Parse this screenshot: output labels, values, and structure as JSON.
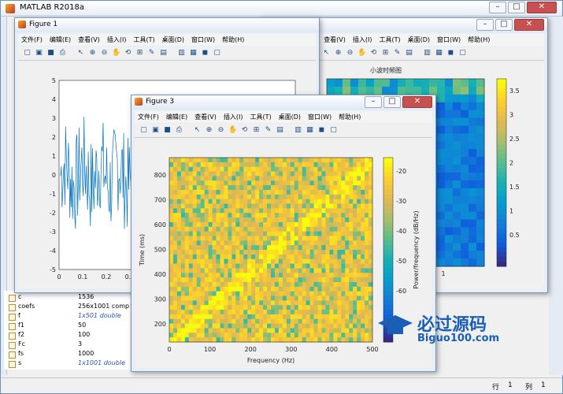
{
  "main": {
    "title": "MATLAB R2018a"
  },
  "menu": [
    "文件(F)",
    "编辑(E)",
    "查看(V)",
    "插入(I)",
    "工具(T)",
    "桌面(D)",
    "窗口(W)",
    "帮助(H)"
  ],
  "fig1": {
    "title": "Figure 1",
    "yticks": [
      "5",
      "4",
      "3",
      "2",
      "1",
      "0",
      "-1",
      "-2",
      "-3",
      "-4",
      "-5"
    ],
    "xticks": [
      "0",
      "0.1",
      "0.2",
      "0.3"
    ]
  },
  "fig2": {
    "title": "小波时频图",
    "colorbar_ticks": [
      "3.5",
      "3",
      "2.5",
      "2",
      "1.5",
      "1",
      "0.5"
    ],
    "xticks": [
      ".8",
      "1"
    ]
  },
  "fig3": {
    "title": "Figure 3",
    "xlabel": "Frequency (Hz)",
    "ylabel": "Time (ms)",
    "cblabel": "Power/frequency (dB/Hz)",
    "xticks": [
      "0",
      "100",
      "200",
      "300",
      "400",
      "500"
    ],
    "yticks": [
      "800",
      "700",
      "600",
      "500",
      "400",
      "300",
      "200"
    ],
    "cbticks": [
      "-20",
      "-30",
      "-40",
      "-50",
      "-60"
    ]
  },
  "workspace": [
    {
      "name": "c",
      "value": "1536",
      "italic": false
    },
    {
      "name": "coefs",
      "value": "256x1001 comp",
      "italic": false
    },
    {
      "name": "f",
      "value": "1x501 double",
      "italic": true
    },
    {
      "name": "f1",
      "value": "50",
      "italic": false
    },
    {
      "name": "f2",
      "value": "100",
      "italic": false
    },
    {
      "name": "Fc",
      "value": "3",
      "italic": false
    },
    {
      "name": "fs",
      "value": "1000",
      "italic": false
    },
    {
      "name": "s",
      "value": "1x1001 double",
      "italic": true
    }
  ],
  "status": {
    "row_label": "行",
    "row": "1",
    "col_label": "列",
    "col": "1"
  },
  "watermark": {
    "cn": "必过源码",
    "url": "Biguo100.com"
  },
  "colors": {
    "parula_low": "#352a87",
    "parula_mid": "#21b3a0",
    "parula_high": "#f9fb0e",
    "line": "#0072bd"
  }
}
